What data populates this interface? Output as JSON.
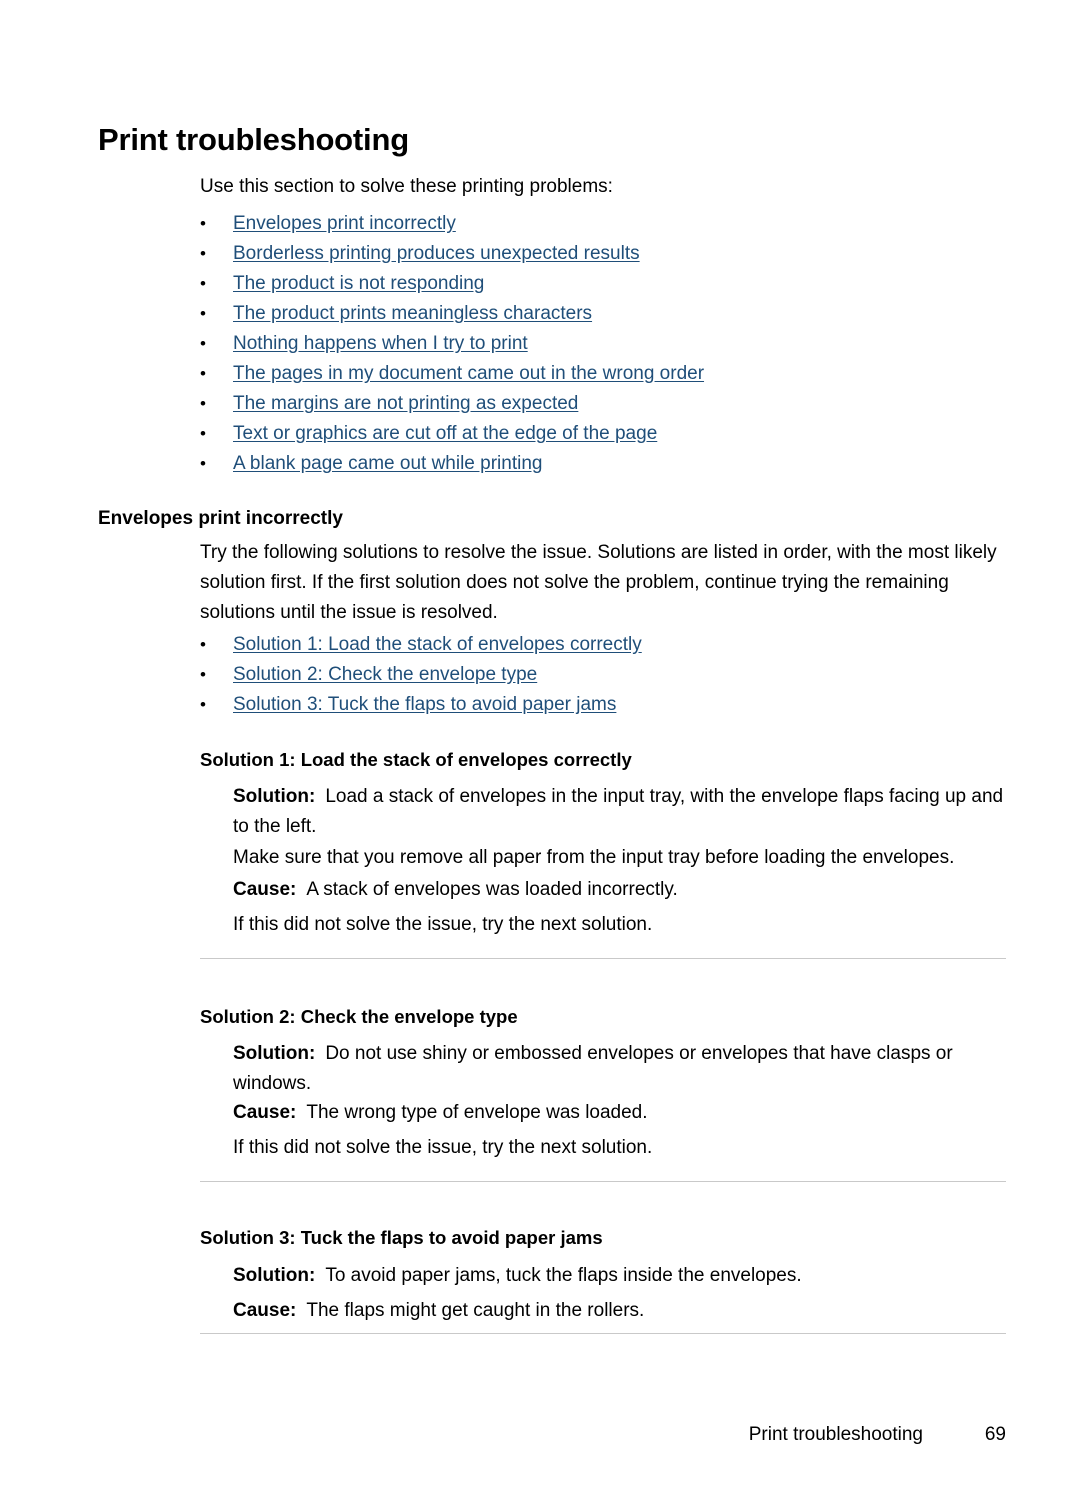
{
  "document": {
    "page_title": "Print troubleshooting",
    "intro": "Use this section to solve these printing problems:"
  },
  "toc_links": [
    {
      "label": "Envelopes print incorrectly"
    },
    {
      "label": "Borderless printing produces unexpected results"
    },
    {
      "label": "The product is not responding"
    },
    {
      "label": "The product prints meaningless characters"
    },
    {
      "label": "Nothing happens when I try to print"
    },
    {
      "label": "The pages in my document came out in the wrong order"
    },
    {
      "label": "The margins are not printing as expected"
    },
    {
      "label": "Text or graphics are cut off at the edge of the page"
    },
    {
      "label": "A blank page came out while printing"
    }
  ],
  "section": {
    "heading": "Envelopes print incorrectly",
    "intro": "Try the following solutions to resolve the issue. Solutions are listed in order, with the most likely solution first. If the first solution does not solve the problem, continue trying the remaining solutions until the issue is resolved.",
    "solution_links": [
      {
        "label": "Solution 1: Load the stack of envelopes correctly"
      },
      {
        "label": "Solution 2: Check the envelope type"
      },
      {
        "label": "Solution 3: Tuck the flaps to avoid paper jams"
      }
    ]
  },
  "labels": {
    "solution": "Solution:",
    "cause": "Cause:",
    "bullet_glyph": "•"
  },
  "solutions": [
    {
      "heading": "Solution 1: Load the stack of envelopes correctly",
      "solution_text": "Load a stack of envelopes in the input tray, with the envelope flaps facing up and to the left.",
      "note_text": "Make sure that you remove all paper from the input tray before loading the envelopes.",
      "cause_text": "A stack of envelopes was loaded incorrectly.",
      "followup_text": "If this did not solve the issue, try the next solution."
    },
    {
      "heading": "Solution 2: Check the envelope type",
      "solution_text": "Do not use shiny or embossed envelopes or envelopes that have clasps or windows.",
      "cause_text": "The wrong type of envelope was loaded.",
      "followup_text": "If this did not solve the issue, try the next solution."
    },
    {
      "heading": "Solution 3: Tuck the flaps to avoid paper jams",
      "solution_text": "To avoid paper jams, tuck the flaps inside the envelopes.",
      "cause_text": "The flaps might get caught in the rollers."
    }
  ],
  "footer": {
    "title": "Print troubleshooting",
    "page_number": "69"
  },
  "colors": {
    "link": "#1F4E79",
    "text": "#000000",
    "rule": "#c9c9c9",
    "background": "#ffffff"
  }
}
